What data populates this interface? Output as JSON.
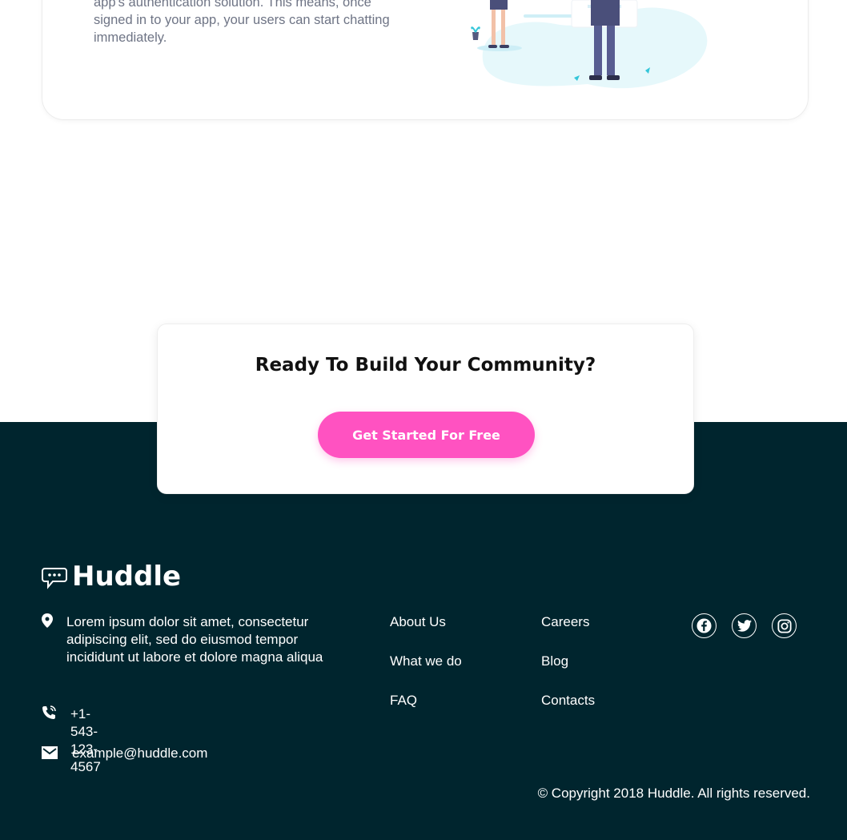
{
  "feature": {
    "description": "app's authentication solution. This means, once signed in to your app, your users can start chatting immediately."
  },
  "cta": {
    "title": "Ready To Build Your Community?",
    "button_label": "Get Started For Free"
  },
  "footer": {
    "brand": "Huddle",
    "address": "Lorem ipsum dolor sit amet, consectetur adipiscing elit, sed do eiusmod tempor incididunt ut labore et dolore magna aliqua",
    "phone": "+1-543-123-4567",
    "email": "example@huddle.com",
    "links_col1": [
      "About Us",
      "What we do",
      "FAQ"
    ],
    "links_col2": [
      "Careers",
      "Blog",
      "Contacts"
    ],
    "social": [
      "facebook-icon",
      "twitter-icon",
      "instagram-icon"
    ],
    "copyright": "© Copyright 2018 Huddle. All rights reserved."
  },
  "colors": {
    "footer_bg": "#00252e",
    "accent_pink": "#ff52c1",
    "text_gray": "#6e7485"
  }
}
